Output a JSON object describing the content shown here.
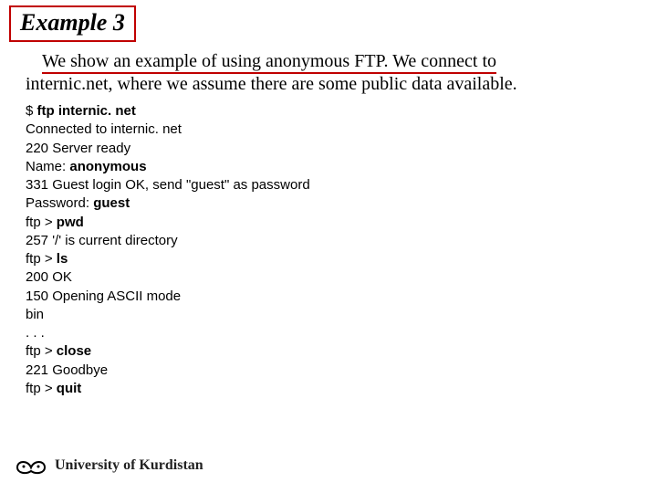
{
  "header": {
    "title": "Example 3"
  },
  "body": {
    "line1": "We show an example of using anonymous FTP. We connect to",
    "line2": "internic.net, where we assume there are some public data available."
  },
  "terminal": {
    "t0a": "$ ",
    "t0b": "ftp internic. net",
    "t1": "Connected to internic. net",
    "t2": "220 Server ready",
    "t3a": "Name: ",
    "t3b": "anonymous",
    "t4": "331 Guest login OK, send \"guest\" as password",
    "t5a": "Password: ",
    "t5b": "guest",
    "t6a": "ftp > ",
    "t6b": "pwd",
    "t7": "257 '/' is current directory",
    "t8a": "ftp > ",
    "t8b": "ls",
    "t9": "200 OK",
    "t10": "150 Opening ASCII mode",
    "t11": "bin",
    "t12": ". . .",
    "t13a": "ftp > ",
    "t13b": "close",
    "t14": "221 Goodbye",
    "t15a": "ftp > ",
    "t15b": "quit"
  },
  "footer": {
    "org": "University of Kurdistan"
  }
}
